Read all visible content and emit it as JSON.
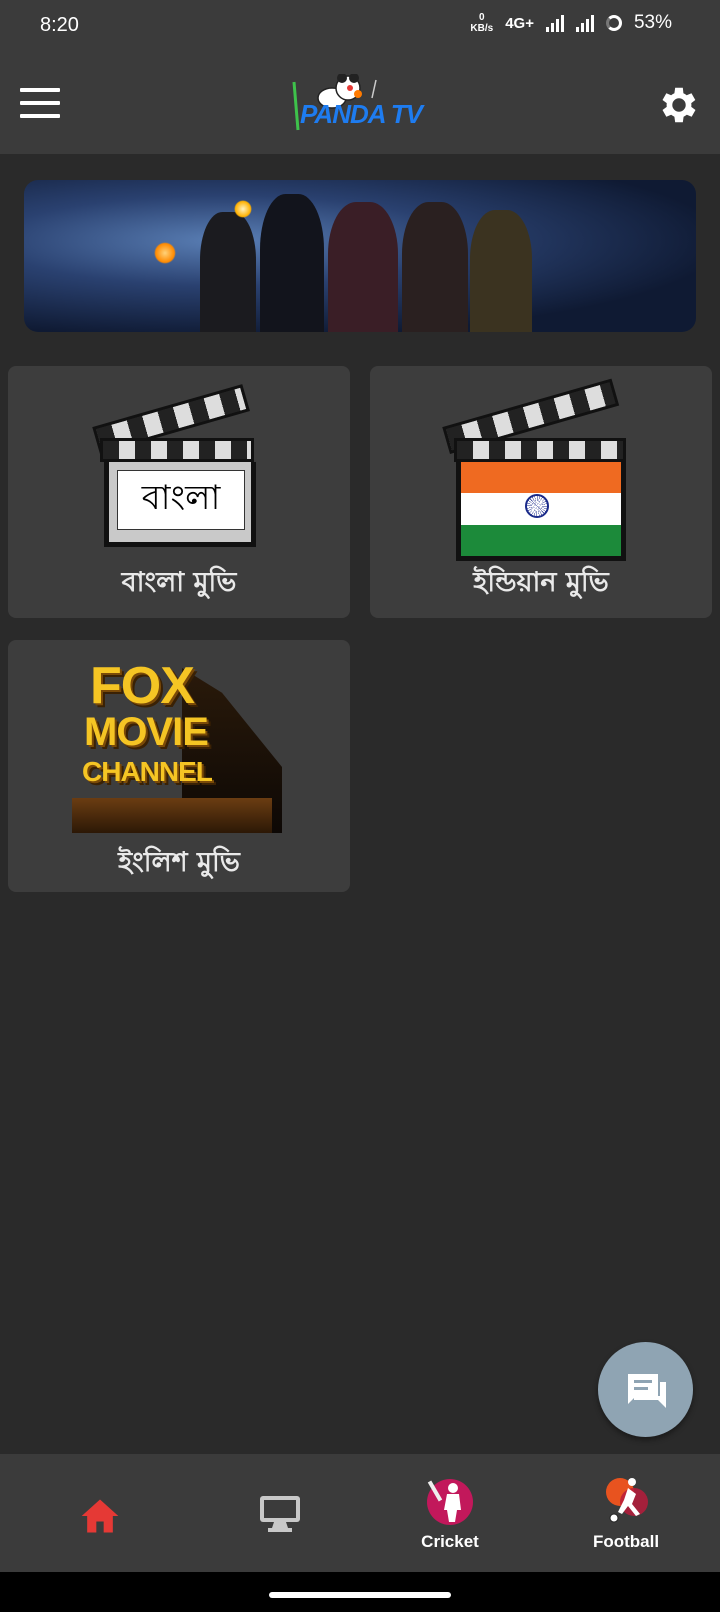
{
  "status_bar": {
    "time": "8:20",
    "net_speed_value": "0",
    "net_speed_unit": "KB/s",
    "network_type": "4G+",
    "battery": "53%"
  },
  "app_bar": {
    "logo_text": "PANDA TV"
  },
  "tiles": [
    {
      "label": "বাংলা মুভি",
      "badge_text": "বাংলা"
    },
    {
      "label": "ইন্ডিয়ান মুভি"
    },
    {
      "label": "ইংলিশ মুভি",
      "logo_lines": [
        "FOX",
        "MOVIE",
        "CHANNEL"
      ]
    }
  ],
  "bottom_nav": {
    "items": [
      {
        "icon": "home-icon",
        "label": ""
      },
      {
        "icon": "monitor-icon",
        "label": ""
      },
      {
        "icon": "cricket-icon",
        "label": "Cricket"
      },
      {
        "icon": "football-icon",
        "label": "Football"
      }
    ]
  },
  "colors": {
    "background": "#2a2a2a",
    "bar": "#3b3b3b",
    "tile": "#3d3d3d",
    "home_active": "#e53935",
    "fab": "#8fa4b3",
    "logo_blue": "#1e7cf0"
  }
}
